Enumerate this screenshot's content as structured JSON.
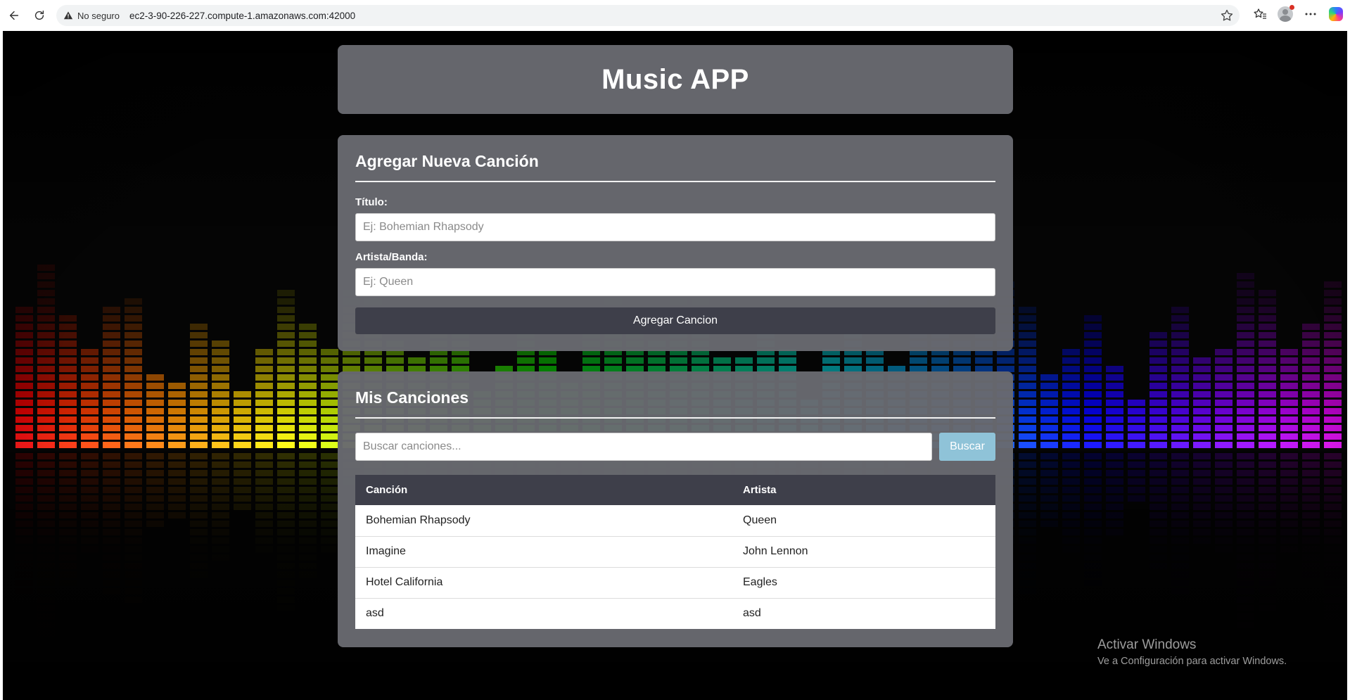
{
  "browser": {
    "security_label": "No seguro",
    "url": "ec2-3-90-226-227.compute-1.amazonaws.com:42000"
  },
  "app": {
    "title": "Music APP"
  },
  "add_song": {
    "heading": "Agregar Nueva Canción",
    "title_label": "Título:",
    "title_placeholder": "Ej: Bohemian Rhapsody",
    "title_value": "",
    "artist_label": "Artista/Banda:",
    "artist_placeholder": "Ej: Queen",
    "artist_value": "",
    "submit_label": "Agregar Cancion"
  },
  "songs": {
    "heading": "Mis Canciones",
    "search_placeholder": "Buscar canciones...",
    "search_value": "",
    "search_button": "Buscar",
    "columns": [
      "Canción",
      "Artista"
    ],
    "rows": [
      {
        "song": "Bohemian Rhapsody",
        "artist": "Queen"
      },
      {
        "song": "Imagine",
        "artist": "John Lennon"
      },
      {
        "song": "Hotel California",
        "artist": "Eagles"
      },
      {
        "song": "asd",
        "artist": "asd"
      }
    ]
  },
  "watermark": {
    "title": "Activar Windows",
    "subtitle": "Ve a Configuración para activar Windows."
  },
  "colors": {
    "card_bg": "#686970",
    "dark_button": "#3e3f4a",
    "search_button": "#8fc3d8"
  },
  "icons": [
    "back-arrow-icon",
    "reload-icon",
    "warning-icon",
    "star-icon",
    "favorites-icon",
    "profile-icon",
    "more-icon",
    "copilot-icon"
  ]
}
